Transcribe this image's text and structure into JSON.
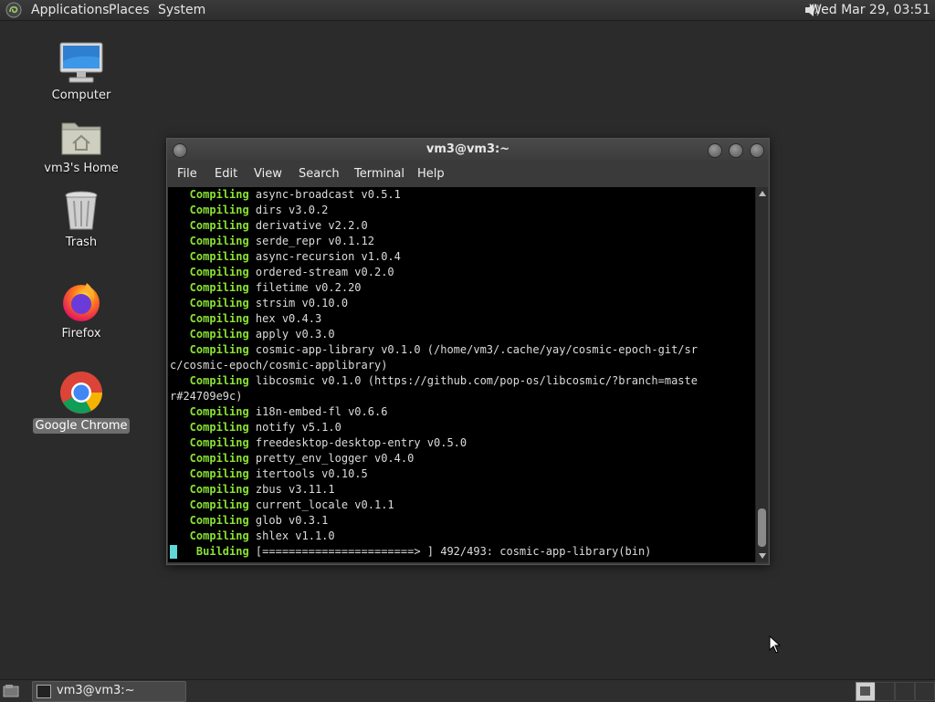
{
  "top_panel": {
    "menus": [
      "Applications",
      "Places",
      "System"
    ],
    "clock": "Wed Mar 29, 03:51"
  },
  "desktop": {
    "icons": [
      {
        "label": "Computer",
        "icon": "computer-icon"
      },
      {
        "label": "vm3's Home",
        "icon": "home-folder-icon"
      },
      {
        "label": "Trash",
        "icon": "trash-icon"
      },
      {
        "label": "Firefox",
        "icon": "firefox-icon"
      },
      {
        "label": "Google Chrome",
        "icon": "chrome-icon"
      }
    ]
  },
  "window": {
    "title": "vm3@vm3:~",
    "menu": [
      "File",
      "Edit",
      "View",
      "Search",
      "Terminal",
      "Help"
    ]
  },
  "terminal": {
    "lines": [
      {
        "kw": "   Compiling",
        "text": " async-broadcast v0.5.1"
      },
      {
        "kw": "   Compiling",
        "text": " dirs v3.0.2"
      },
      {
        "kw": "   Compiling",
        "text": " derivative v2.2.0"
      },
      {
        "kw": "   Compiling",
        "text": " serde_repr v0.1.12"
      },
      {
        "kw": "   Compiling",
        "text": " async-recursion v1.0.4"
      },
      {
        "kw": "   Compiling",
        "text": " ordered-stream v0.2.0"
      },
      {
        "kw": "   Compiling",
        "text": " filetime v0.2.20"
      },
      {
        "kw": "   Compiling",
        "text": " strsim v0.10.0"
      },
      {
        "kw": "   Compiling",
        "text": " hex v0.4.3"
      },
      {
        "kw": "   Compiling",
        "text": " apply v0.3.0"
      },
      {
        "kw": "   Compiling",
        "text": " cosmic-app-library v0.1.0 (/home/vm3/.cache/yay/cosmic-epoch-git/sr"
      },
      {
        "kw": "",
        "text": "c/cosmic-epoch/cosmic-applibrary)"
      },
      {
        "kw": "   Compiling",
        "text": " libcosmic v0.1.0 (https://github.com/pop-os/libcosmic/?branch=maste"
      },
      {
        "kw": "",
        "text": "r#24709e9c)"
      },
      {
        "kw": "   Compiling",
        "text": " i18n-embed-fl v0.6.6"
      },
      {
        "kw": "   Compiling",
        "text": " notify v5.1.0"
      },
      {
        "kw": "   Compiling",
        "text": " freedesktop-desktop-entry v0.5.0"
      },
      {
        "kw": "   Compiling",
        "text": " pretty_env_logger v0.4.0"
      },
      {
        "kw": "   Compiling",
        "text": " itertools v0.10.5"
      },
      {
        "kw": "   Compiling",
        "text": " zbus v3.11.1"
      },
      {
        "kw": "   Compiling",
        "text": " current_locale v0.1.1"
      },
      {
        "kw": "   Compiling",
        "text": " glob v0.3.1"
      },
      {
        "kw": "   Compiling",
        "text": " shlex v1.1.0"
      }
    ],
    "progress": {
      "kw": "    Building",
      "text": " [=======================> ] 492/493: cosmic-app-library(bin)"
    }
  },
  "taskbar": {
    "task_label": "vm3@vm3:~"
  }
}
